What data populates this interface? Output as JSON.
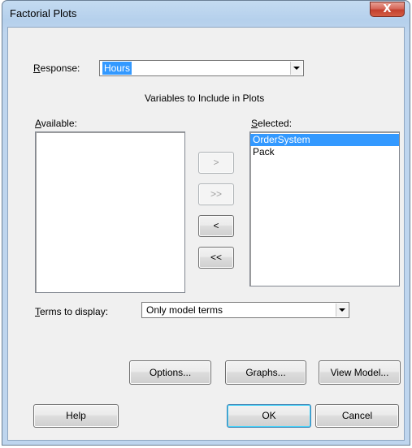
{
  "window": {
    "title": "Factorial Plots",
    "close_glyph": "X"
  },
  "response": {
    "label": "Response:",
    "value": "Hours"
  },
  "variables_heading": "Variables to Include in Plots",
  "available": {
    "label": "Available:",
    "items": []
  },
  "selected": {
    "label": "Selected:",
    "items": [
      "OrderSystem",
      "Pack"
    ],
    "selected_item": "OrderSystem"
  },
  "move_buttons": {
    "add": ">",
    "add_all": ">>",
    "remove": "<",
    "remove_all": "<<"
  },
  "terms": {
    "label": "Terms to display:",
    "value": "Only model terms"
  },
  "buttons": {
    "options": "Options...",
    "graphs": "Graphs...",
    "view_model": "View Model...",
    "help": "Help",
    "ok": "OK",
    "cancel": "Cancel"
  }
}
